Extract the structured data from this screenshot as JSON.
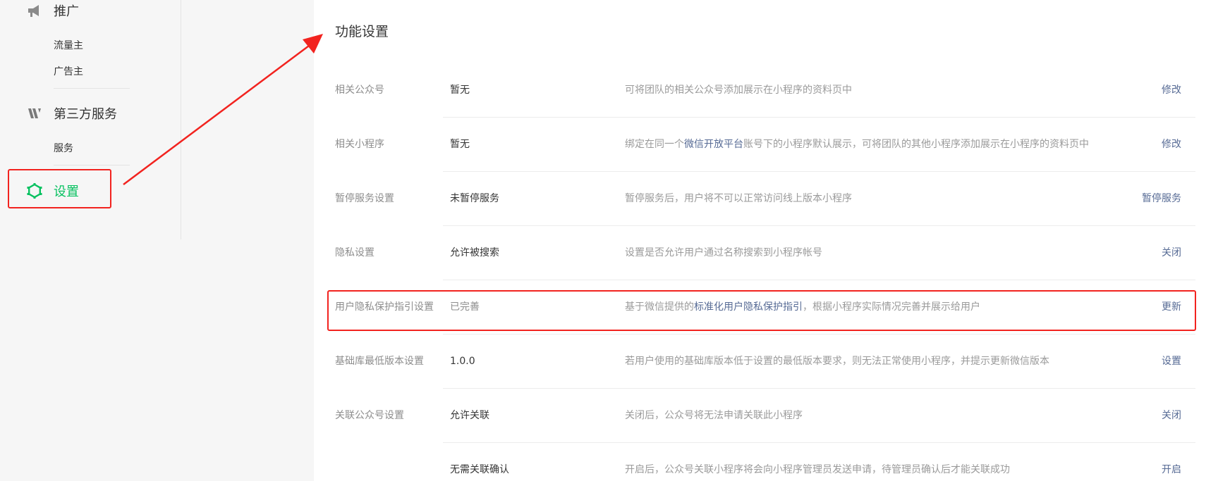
{
  "sidebar": {
    "promotion": {
      "label": "推广",
      "icon": "megaphone-icon",
      "items": [
        "流量主",
        "广告主"
      ]
    },
    "third_party": {
      "label": "第三方服务",
      "icon": "third-party-icon",
      "items": [
        "服务"
      ]
    },
    "settings": {
      "label": "设置",
      "icon": "gear-icon",
      "color": "#07c160"
    }
  },
  "main": {
    "title": "功能设置",
    "rows": [
      {
        "label": "相关公众号",
        "value": "暂无",
        "desc": "可将团队的相关公众号添加展示在小程序的资料页中",
        "action": "修改"
      },
      {
        "label": "相关小程序",
        "value": "暂无",
        "desc_pre": "绑定在同一个",
        "desc_link": "微信开放平台",
        "desc_post": "账号下的小程序默认展示，可将团队的其他小程序添加展示在小程序的资料页中",
        "action": "修改"
      },
      {
        "label": "暂停服务设置",
        "value": "未暂停服务",
        "desc": "暂停服务后，用户将不可以正常访问线上版本小程序",
        "action": "暂停服务"
      },
      {
        "label": "隐私设置",
        "value": "允许被搜索",
        "desc": "设置是否允许用户通过名称搜索到小程序帐号",
        "action": "关闭"
      },
      {
        "label": "用户隐私保护指引设置",
        "value": "已完善",
        "desc_pre": "基于微信提供的",
        "desc_link": "标准化用户隐私保护指引",
        "desc_post": "，根据小程序实际情况完善并展示给用户",
        "action": "更新"
      },
      {
        "label": "基础库最低版本设置",
        "value": "1.0.0",
        "desc": "若用户使用的基础库版本低于设置的最低版本要求，则无法正常使用小程序，并提示更新微信版本",
        "action": "设置"
      },
      {
        "label": "关联公众号设置",
        "value": "允许关联",
        "desc": "关闭后，公众号将无法申请关联此小程序",
        "action": "关闭"
      },
      {
        "label": "",
        "value": "无需关联确认",
        "desc": "开启后，公众号关联小程序将会向小程序管理员发送申请，待管理员确认后才能关联成功",
        "action": "开启"
      }
    ]
  },
  "colors": {
    "link": "#576b95",
    "accent": "#07c160",
    "annotation": "#f2231f"
  }
}
